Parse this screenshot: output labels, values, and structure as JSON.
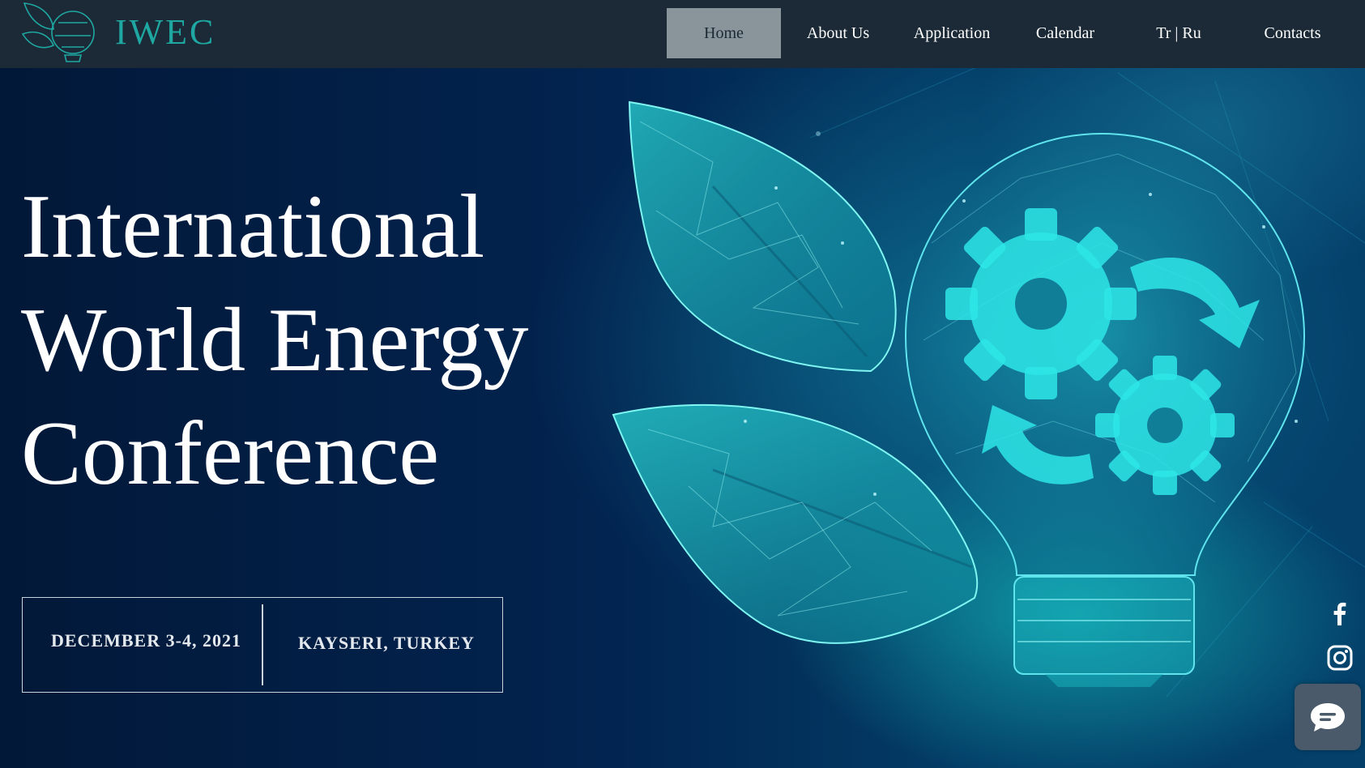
{
  "brand": {
    "name": "IWEC",
    "accent_color": "#1fa8a2",
    "logo_icon": "leaf-globe-logo-icon"
  },
  "nav": {
    "items": [
      {
        "label": "Home",
        "active": true
      },
      {
        "label": "About Us",
        "active": false
      },
      {
        "label": "Application",
        "active": false
      },
      {
        "label": "Calendar",
        "active": false
      },
      {
        "label": "Tr | Ru",
        "active": false
      },
      {
        "label": "Contacts",
        "active": false
      }
    ]
  },
  "hero": {
    "title_lines": [
      "International",
      "World Energy",
      "Conference"
    ],
    "date": "DECEMBER 3-4, 2021",
    "location": "KAYSERI, TURKEY",
    "illustration": "lightbulb-leaves-gears-icon"
  },
  "social": [
    {
      "icon": "facebook-icon"
    },
    {
      "icon": "instagram-icon"
    }
  ],
  "chat": {
    "icon": "chat-bubble-icon"
  }
}
